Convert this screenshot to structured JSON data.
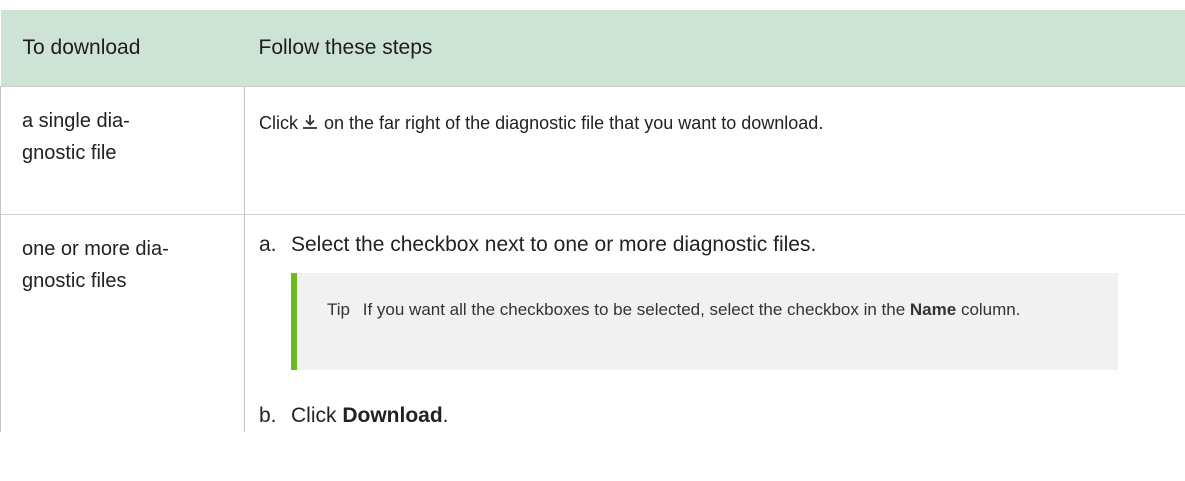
{
  "table": {
    "headers": [
      "To download",
      "Follow these steps"
    ],
    "rows": [
      {
        "target": "a single diagnostic file",
        "target_line1": "a single dia-",
        "target_line2": "gnostic file",
        "step_before_icon": "Click",
        "step_icon": "download-icon",
        "step_after_icon": "on the far right of the diagnostic file that you want to download."
      },
      {
        "target": "one or more diagnostic files",
        "target_line1": "one or more dia-",
        "target_line2": "gnostic files",
        "steps": [
          {
            "marker": "a.",
            "text": "Select the checkbox next to one or more diagnostic files."
          },
          {
            "marker": "b.",
            "text_before": "Click",
            "bold": "Download",
            "text_after": "."
          }
        ],
        "tip": {
          "label": "Tip",
          "text_before": "If you want all the checkboxes to be selected, select the checkbox in the",
          "bold": "Name",
          "text_after": "column."
        }
      }
    ]
  },
  "colors": {
    "header_bg": "#cce3d5",
    "tip_bg": "#f1f1f1",
    "tip_accent": "#6fbb1e"
  }
}
